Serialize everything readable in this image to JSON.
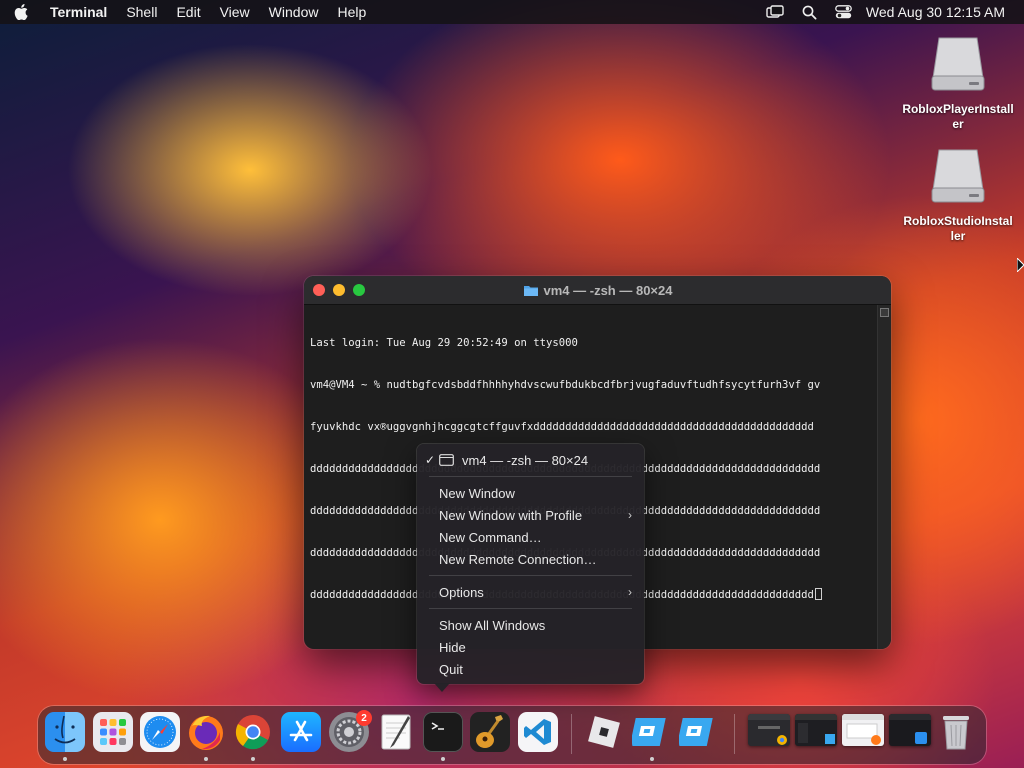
{
  "menubar": {
    "app_name": "Terminal",
    "items": [
      "Shell",
      "Edit",
      "View",
      "Window",
      "Help"
    ],
    "clock": "Wed Aug 30  12:15 AM"
  },
  "desktop": {
    "icons": [
      {
        "label": "RobloxPlayerInstaller"
      },
      {
        "label": "RobloxStudioInstaller"
      }
    ]
  },
  "terminal": {
    "title": "vm4 — -zsh — 80×24",
    "lines": [
      "Last login: Tue Aug 29 20:52:49 on ttys000",
      "vm4@VM4 ~ % nudtbgfcvdsbddfhhhhyhdvscwufbdukbcdfbrjvugfaduvftudhfsycytfurh3vf gv",
      "fyuvkhdc vx®uggvgnhjhcggcgtcffguvfxdddddddddddddddddddddddddddddddddddddddddddd",
      "dddddddddddddddddddddddddddddddddddddddddddddddddddddddddddddddddddddddddddddddd",
      "dddddddddddddddddddddddddddddddddddddddddddddddddddddddddddddddddddddddddddddddd",
      "dddddddddddddddddddddddddddddddddddddddddddddddddddddddddddddddddddddddddddddddd",
      "ddddddddddddddddddddddddddddddddddddddddddddddddddddddddddddddddddddddddddddddd"
    ]
  },
  "context_menu": {
    "current_window": "vm4 — -zsh — 80×24",
    "group1": [
      "New Window",
      "New Window with Profile",
      "New Command…",
      "New Remote Connection…"
    ],
    "options": "Options",
    "group3": [
      "Show All Windows",
      "Hide",
      "Quit"
    ]
  },
  "dock": {
    "apps": [
      "finder",
      "launchpad",
      "safari",
      "firefox",
      "chrome",
      "app-store",
      "system-settings",
      "textedit",
      "terminal",
      "garageband",
      "vscode",
      "roblox-player",
      "roblox-studio",
      "roblox-studio-2"
    ],
    "settings_badge": "2"
  },
  "colors": {
    "close": "#ff5f57",
    "minimize": "#febc2e",
    "zoom": "#28c840",
    "badge": "#ff3b30",
    "terminal_bg": "#1e1e1e"
  }
}
